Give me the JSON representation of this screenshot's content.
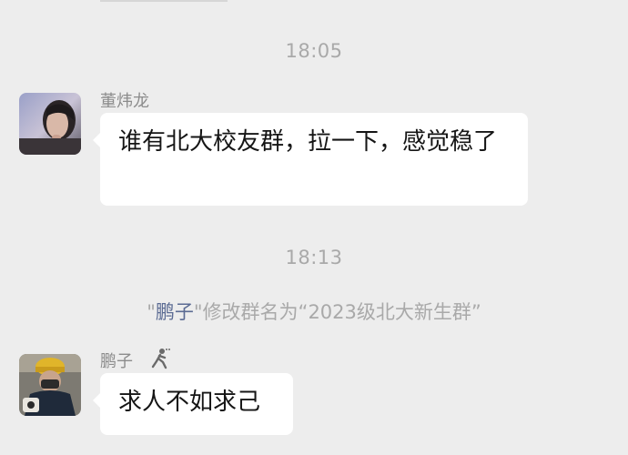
{
  "messages": [
    {
      "timestamp": "18:05",
      "sender": "董炜龙",
      "text": "谁有北大校友群，拉一下，感觉稳了"
    },
    {
      "timestamp": "18:13",
      "system_notice": {
        "quote_open": "\"",
        "actor": "鹏子",
        "quote_close": "\"",
        "action": "修改群名为“2023级北大新生群”"
      }
    },
    {
      "sender": "鹏子",
      "badge_icon": "walking-figure-icon",
      "text": "求人不如求己"
    }
  ],
  "colors": {
    "background": "#ededed",
    "bubble": "#ffffff",
    "timestamp_text": "#a9a9a9",
    "sender_text": "#8c8c8c",
    "name_link": "#5b6b93"
  }
}
